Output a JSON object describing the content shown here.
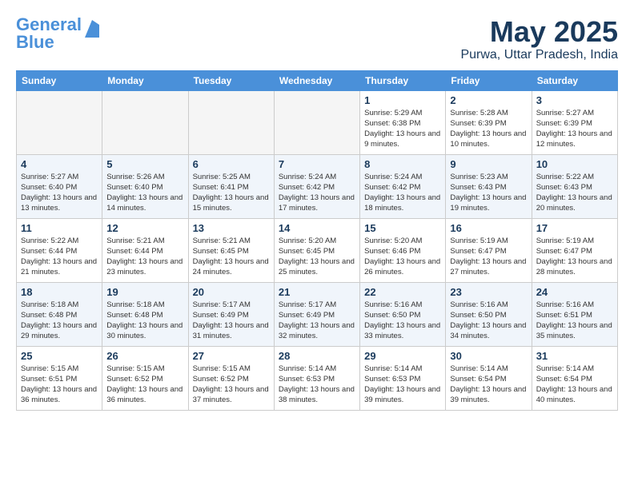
{
  "header": {
    "logo_line1": "General",
    "logo_line2": "Blue",
    "month": "May 2025",
    "location": "Purwa, Uttar Pradesh, India"
  },
  "days_of_week": [
    "Sunday",
    "Monday",
    "Tuesday",
    "Wednesday",
    "Thursday",
    "Friday",
    "Saturday"
  ],
  "weeks": [
    [
      {
        "num": "",
        "empty": true
      },
      {
        "num": "",
        "empty": true
      },
      {
        "num": "",
        "empty": true
      },
      {
        "num": "",
        "empty": true
      },
      {
        "num": "1",
        "sunrise": "5:29 AM",
        "sunset": "6:38 PM",
        "daylight": "13 hours and 9 minutes."
      },
      {
        "num": "2",
        "sunrise": "5:28 AM",
        "sunset": "6:39 PM",
        "daylight": "13 hours and 10 minutes."
      },
      {
        "num": "3",
        "sunrise": "5:27 AM",
        "sunset": "6:39 PM",
        "daylight": "13 hours and 12 minutes."
      }
    ],
    [
      {
        "num": "4",
        "sunrise": "5:27 AM",
        "sunset": "6:40 PM",
        "daylight": "13 hours and 13 minutes."
      },
      {
        "num": "5",
        "sunrise": "5:26 AM",
        "sunset": "6:40 PM",
        "daylight": "13 hours and 14 minutes."
      },
      {
        "num": "6",
        "sunrise": "5:25 AM",
        "sunset": "6:41 PM",
        "daylight": "13 hours and 15 minutes."
      },
      {
        "num": "7",
        "sunrise": "5:24 AM",
        "sunset": "6:42 PM",
        "daylight": "13 hours and 17 minutes."
      },
      {
        "num": "8",
        "sunrise": "5:24 AM",
        "sunset": "6:42 PM",
        "daylight": "13 hours and 18 minutes."
      },
      {
        "num": "9",
        "sunrise": "5:23 AM",
        "sunset": "6:43 PM",
        "daylight": "13 hours and 19 minutes."
      },
      {
        "num": "10",
        "sunrise": "5:22 AM",
        "sunset": "6:43 PM",
        "daylight": "13 hours and 20 minutes."
      }
    ],
    [
      {
        "num": "11",
        "sunrise": "5:22 AM",
        "sunset": "6:44 PM",
        "daylight": "13 hours and 21 minutes."
      },
      {
        "num": "12",
        "sunrise": "5:21 AM",
        "sunset": "6:44 PM",
        "daylight": "13 hours and 23 minutes."
      },
      {
        "num": "13",
        "sunrise": "5:21 AM",
        "sunset": "6:45 PM",
        "daylight": "13 hours and 24 minutes."
      },
      {
        "num": "14",
        "sunrise": "5:20 AM",
        "sunset": "6:45 PM",
        "daylight": "13 hours and 25 minutes."
      },
      {
        "num": "15",
        "sunrise": "5:20 AM",
        "sunset": "6:46 PM",
        "daylight": "13 hours and 26 minutes."
      },
      {
        "num": "16",
        "sunrise": "5:19 AM",
        "sunset": "6:47 PM",
        "daylight": "13 hours and 27 minutes."
      },
      {
        "num": "17",
        "sunrise": "5:19 AM",
        "sunset": "6:47 PM",
        "daylight": "13 hours and 28 minutes."
      }
    ],
    [
      {
        "num": "18",
        "sunrise": "5:18 AM",
        "sunset": "6:48 PM",
        "daylight": "13 hours and 29 minutes."
      },
      {
        "num": "19",
        "sunrise": "5:18 AM",
        "sunset": "6:48 PM",
        "daylight": "13 hours and 30 minutes."
      },
      {
        "num": "20",
        "sunrise": "5:17 AM",
        "sunset": "6:49 PM",
        "daylight": "13 hours and 31 minutes."
      },
      {
        "num": "21",
        "sunrise": "5:17 AM",
        "sunset": "6:49 PM",
        "daylight": "13 hours and 32 minutes."
      },
      {
        "num": "22",
        "sunrise": "5:16 AM",
        "sunset": "6:50 PM",
        "daylight": "13 hours and 33 minutes."
      },
      {
        "num": "23",
        "sunrise": "5:16 AM",
        "sunset": "6:50 PM",
        "daylight": "13 hours and 34 minutes."
      },
      {
        "num": "24",
        "sunrise": "5:16 AM",
        "sunset": "6:51 PM",
        "daylight": "13 hours and 35 minutes."
      }
    ],
    [
      {
        "num": "25",
        "sunrise": "5:15 AM",
        "sunset": "6:51 PM",
        "daylight": "13 hours and 36 minutes."
      },
      {
        "num": "26",
        "sunrise": "5:15 AM",
        "sunset": "6:52 PM",
        "daylight": "13 hours and 36 minutes."
      },
      {
        "num": "27",
        "sunrise": "5:15 AM",
        "sunset": "6:52 PM",
        "daylight": "13 hours and 37 minutes."
      },
      {
        "num": "28",
        "sunrise": "5:14 AM",
        "sunset": "6:53 PM",
        "daylight": "13 hours and 38 minutes."
      },
      {
        "num": "29",
        "sunrise": "5:14 AM",
        "sunset": "6:53 PM",
        "daylight": "13 hours and 39 minutes."
      },
      {
        "num": "30",
        "sunrise": "5:14 AM",
        "sunset": "6:54 PM",
        "daylight": "13 hours and 39 minutes."
      },
      {
        "num": "31",
        "sunrise": "5:14 AM",
        "sunset": "6:54 PM",
        "daylight": "13 hours and 40 minutes."
      }
    ]
  ]
}
